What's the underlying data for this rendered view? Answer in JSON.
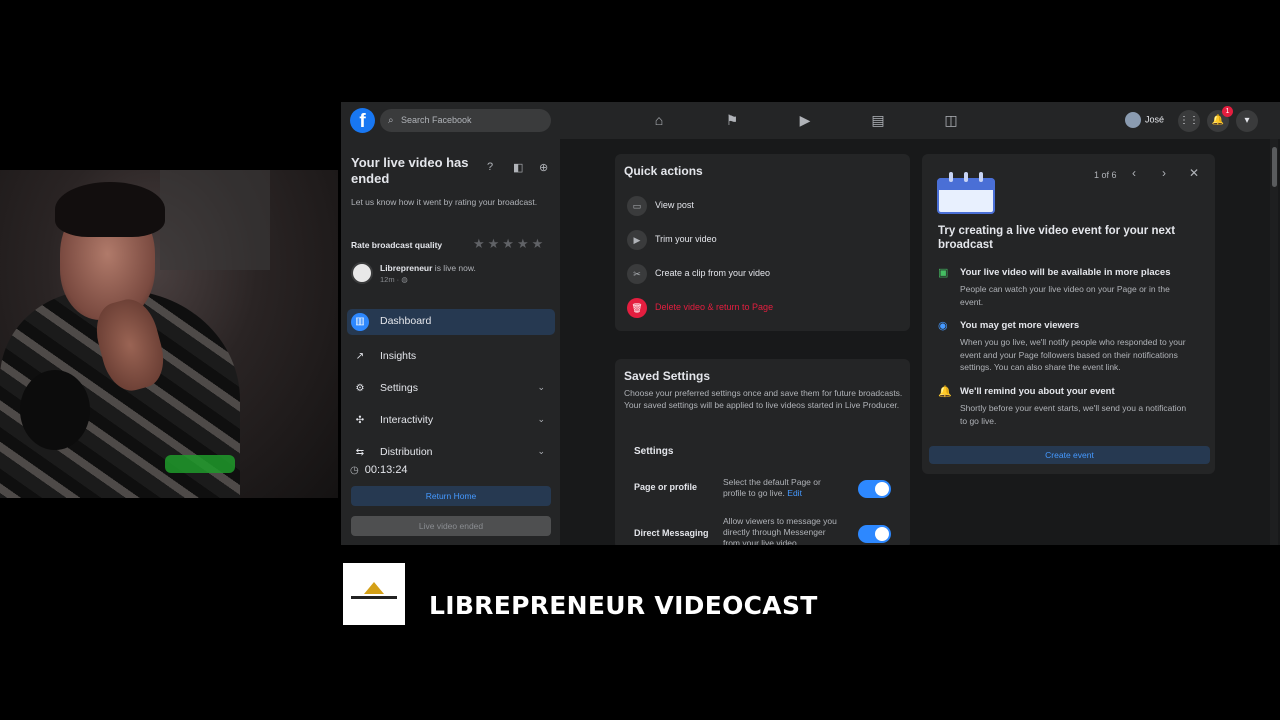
{
  "topbar": {
    "search_placeholder": "Search Facebook",
    "user_name": "José",
    "notification_count": "1"
  },
  "left_panel": {
    "title": "Your live video has ended",
    "subtitle": "Let us know how it went by rating your broadcast.",
    "rate_label": "Rate broadcast quality",
    "stars": "★★★★★",
    "page_name": "Librepreneur",
    "live_status": " is live now.",
    "live_time": "12m · ◍",
    "menu": [
      {
        "label": "Dashboard"
      },
      {
        "label": "Insights"
      },
      {
        "label": "Settings"
      },
      {
        "label": "Interactivity"
      },
      {
        "label": "Distribution"
      }
    ],
    "timer": "00:13:24",
    "return_home": "Return Home",
    "live_ended": "Live video ended"
  },
  "quick_actions": {
    "title": "Quick actions",
    "items": [
      {
        "label": "View post"
      },
      {
        "label": "Trim your video"
      },
      {
        "label": "Create a clip from your video"
      },
      {
        "label": "Delete video & return to Page"
      }
    ]
  },
  "saved_settings": {
    "title": "Saved Settings",
    "description": "Choose your preferred settings once and save them for future broadcasts. Your saved settings will be applied to live videos started in Live Producer.",
    "section": "Settings",
    "rows": [
      {
        "label": "Page or profile",
        "desc": "Select the default Page or profile to go live.",
        "link": "Edit",
        "enabled": true
      },
      {
        "label": "Direct Messaging",
        "desc": "Allow viewers to message you directly through Messenger from your live video.",
        "link": "",
        "enabled": true
      }
    ]
  },
  "event_card": {
    "pager": "1 of 6",
    "title": "Try creating a live video event for your next broadcast",
    "items": [
      {
        "icon": "screen-icon",
        "title": "Your live video will be available in more places",
        "desc": "People can watch your live video on your Page or in the event."
      },
      {
        "icon": "eye-icon",
        "title": "You may get more viewers",
        "desc": "When you go live, we'll notify people who responded to your event and your Page followers based on their notifications settings. You can also share the event link."
      },
      {
        "icon": "bell-icon",
        "title": "We'll remind you about your event",
        "desc": "Shortly before your event starts, we'll send you a notification to go live."
      }
    ],
    "button": "Create event"
  },
  "branding": {
    "title": "LIBREPRENEUR VIDEOCAST",
    "logo_text": "LIBREPRENEUR"
  },
  "colors": {
    "accent": "#2d88ff",
    "danger": "#e41e3f",
    "background": "#18191a",
    "surface": "#242526"
  }
}
